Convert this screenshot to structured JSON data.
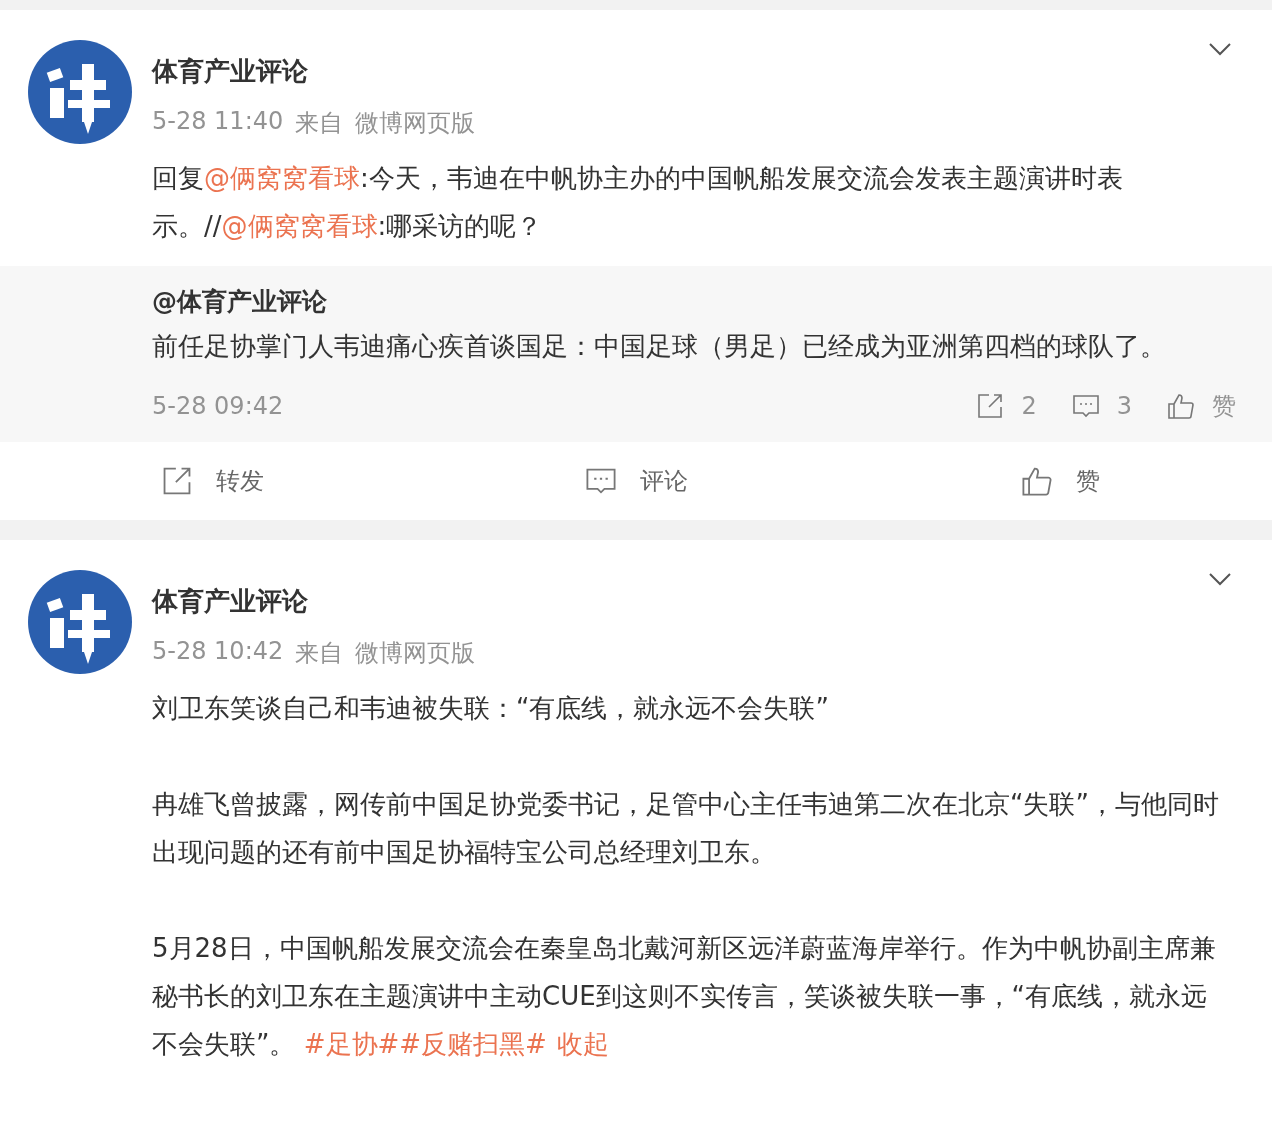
{
  "posts": [
    {
      "author": "体育产业评论",
      "time": "5-28 11:40",
      "source_label": "来自",
      "source": "微博网页版",
      "text": [
        {
          "kind": "text",
          "text": "回复"
        },
        {
          "kind": "link",
          "text": "@俩窝窝看球"
        },
        {
          "kind": "text",
          "text": ":今天，韦迪在中帆协主办的中国帆船发展交流会发表主题演讲时表示。//"
        },
        {
          "kind": "link",
          "text": "@俩窝窝看球"
        },
        {
          "kind": "text",
          "text": ":哪采访的呢？"
        }
      ],
      "quote": {
        "author": "@体育产业评论",
        "text": "前任足协掌门人韦迪痛心疾首谈国足：中国足球（男足）已经成为亚洲第四档的球队了。",
        "time": "5-28 09:42",
        "reposts": "2",
        "comments": "3",
        "like_label": "赞"
      },
      "actions": [
        {
          "kind": "repost",
          "label": "转发"
        },
        {
          "kind": "comment",
          "label": "评论"
        },
        {
          "kind": "like",
          "label": "赞"
        }
      ]
    },
    {
      "author": "体育产业评论",
      "time": "5-28 10:42",
      "source_label": "来自",
      "source": "微博网页版",
      "paragraphs": [
        [
          {
            "kind": "text",
            "text": "刘卫东笑谈自己和韦迪被失联：“有底线，就永远不会失联”"
          }
        ],
        [
          {
            "kind": "text",
            "text": "冉雄飞曾披露，网传前中国足协党委书记，足管中心主任韦迪第二次在北京“失联”，与他同时出现问题的还有前中国足协福特宝公司总经理刘卫东。"
          }
        ],
        [
          {
            "kind": "text",
            "text": "5月28日，中国帆船发展交流会在秦皇岛北戴河新区远洋蔚蓝海岸举行。作为中帆协副主席兼秘书长的刘卫东在主题演讲中主动CUE到这则不实传言，笑谈被失联一事，“有底线，就永远不会失联”。 "
          },
          {
            "kind": "link",
            "text": "#足协##反赌扫黑#"
          },
          {
            "kind": "action",
            "text": "收起"
          }
        ]
      ]
    }
  ]
}
